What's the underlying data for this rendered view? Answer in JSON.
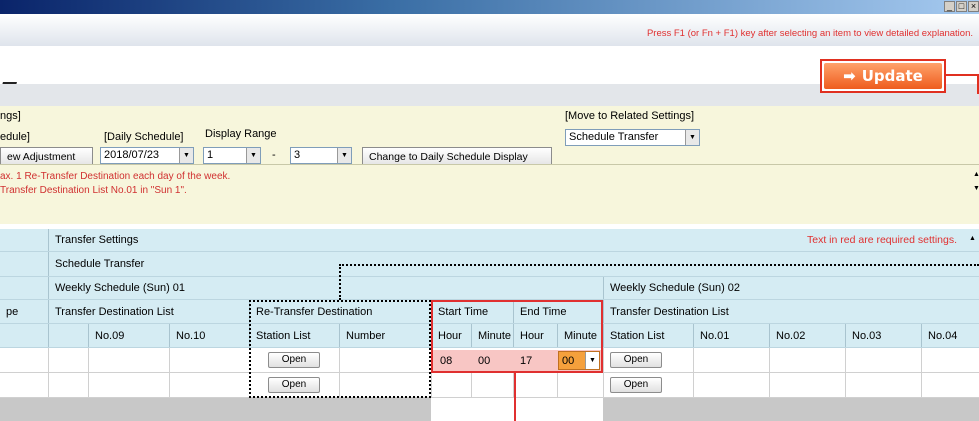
{
  "window": {
    "min_btn": "_",
    "max_btn": "□",
    "close_btn": "×"
  },
  "help_text": "Press F1 (or Fn + F1) key after selecting an item to view detailed explanation.",
  "update_label": "Update",
  "settings": {
    "header_left": "ngs]",
    "sub_left": "edule]",
    "daily_schedule_label": "[Daily Schedule]",
    "display_range_label": "Display Range",
    "move_related_label": "[Move to Related Settings]",
    "related_value": "Schedule Transfer",
    "view_adjust_label": "ew Adjustment",
    "date_value": "2018/07/23",
    "range_from": "1",
    "range_sep": "-",
    "range_to": "3",
    "change_btn_label": "Change to Daily Schedule Display"
  },
  "messages": [
    "ax. 1 Re-Transfer Destination each day of the week.",
    "Transfer Destination List No.01 in \"Sun 1\"."
  ],
  "grid": {
    "transfer_settings": "Transfer Settings",
    "required_note": "Text in red are required settings.",
    "schedule_transfer": "Schedule Transfer",
    "weekly1": "Weekly Schedule (Sun) 01",
    "weekly2": "Weekly Schedule (Sun) 02",
    "pe": "pe",
    "tdl": "Transfer Destination List",
    "retransfer": "Re-Transfer Destination",
    "start_time": "Start Time",
    "end_time": "End Time",
    "tdl2": "Transfer Destination List",
    "col_no09": "No.09",
    "col_no10": "No.10",
    "col_station": "Station List",
    "col_number": "Number",
    "col_hour1": "Hour",
    "col_minute1": "Minute",
    "col_hour2": "Hour",
    "col_minute2": "Minute",
    "col_station2": "Station List",
    "col_no01": "No.01",
    "col_no02": "No.02",
    "col_no03": "No.03",
    "col_no04": "No.04",
    "open1": "Open",
    "open2": "Open",
    "open3": "Open",
    "open4": "Open",
    "start_hour": "08",
    "start_minute": "00",
    "end_hour": "17",
    "end_minute": "00"
  },
  "colors": {
    "accent_red": "#e03030",
    "update_orange": "#ee5c1e",
    "header_blue": "#d5ecf3",
    "settings_bg": "#f7f6dc"
  }
}
